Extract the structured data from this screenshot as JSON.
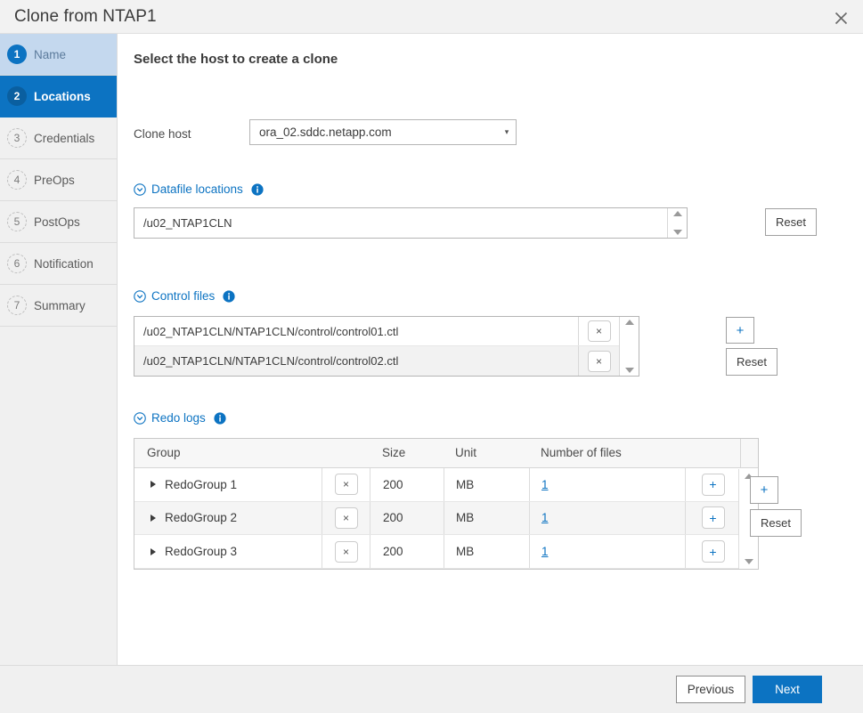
{
  "window": {
    "title": "Clone from NTAP1",
    "close_icon": "close-icon"
  },
  "sidebar": {
    "steps": [
      {
        "num": "1",
        "label": "Name",
        "state": "done"
      },
      {
        "num": "2",
        "label": "Locations",
        "state": "active"
      },
      {
        "num": "3",
        "label": "Credentials",
        "state": "todo"
      },
      {
        "num": "4",
        "label": "PreOps",
        "state": "todo"
      },
      {
        "num": "5",
        "label": "PostOps",
        "state": "todo"
      },
      {
        "num": "6",
        "label": "Notification",
        "state": "todo"
      },
      {
        "num": "7",
        "label": "Summary",
        "state": "todo"
      }
    ]
  },
  "main": {
    "heading": "Select the host to create a clone",
    "clone_host": {
      "label": "Clone host",
      "value": "ora_02.sddc.netapp.com",
      "caret_icon": "chevron-down-icon"
    },
    "datafile_locations": {
      "title": "Datafile locations",
      "collapse_icon": "chevron-down-circle-icon",
      "info_icon": "info-icon",
      "entries": [
        "/u02_NTAP1CLN"
      ],
      "reset_label": "Reset",
      "scroll_up_icon": "caret-up-icon",
      "scroll_down_icon": "caret-down-icon"
    },
    "control_files": {
      "title": "Control files",
      "collapse_icon": "chevron-down-circle-icon",
      "info_icon": "info-icon",
      "entries": [
        "/u02_NTAP1CLN/NTAP1CLN/control/control01.ctl",
        "/u02_NTAP1CLN/NTAP1CLN/control/control02.ctl"
      ],
      "delete_label": "×",
      "add_label": "+",
      "reset_label": "Reset",
      "scroll_up_icon": "caret-up-icon",
      "scroll_down_icon": "caret-down-icon"
    },
    "redo_logs": {
      "title": "Redo logs",
      "collapse_icon": "chevron-down-circle-icon",
      "info_icon": "info-icon",
      "columns": [
        "Group",
        "Size",
        "Unit",
        "Number of files"
      ],
      "rows": [
        {
          "group": "RedoGroup 1",
          "size": "200",
          "unit": "MB",
          "files": "1"
        },
        {
          "group": "RedoGroup 2",
          "size": "200",
          "unit": "MB",
          "files": "1"
        },
        {
          "group": "RedoGroup 3",
          "size": "200",
          "unit": "MB",
          "files": "1"
        }
      ],
      "delete_label": "×",
      "row_add_label": "+",
      "add_label": "+",
      "reset_label": "Reset",
      "expand_icon": "caret-right-icon",
      "scroll_up_icon": "caret-up-icon",
      "scroll_down_icon": "caret-down-icon"
    }
  },
  "footer": {
    "previous_label": "Previous",
    "next_label": "Next"
  },
  "colors": {
    "accent": "#0c73c2",
    "accent_dark": "#0a5fa0",
    "step_done_bg": "#c4d8ee",
    "chrome_bg": "#f0f0f0",
    "titlebar_bg": "#f2f2f2"
  }
}
